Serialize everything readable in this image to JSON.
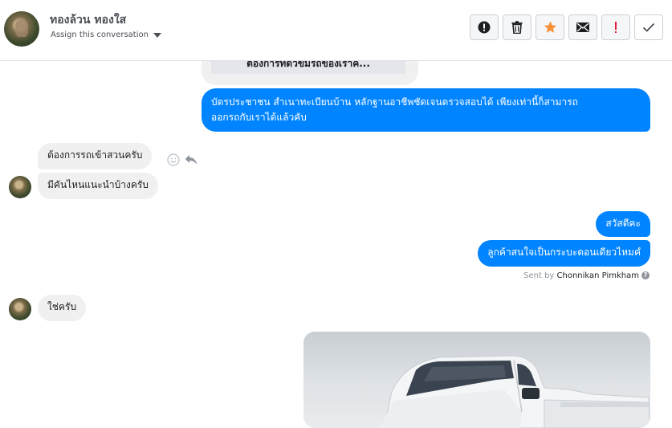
{
  "header": {
    "contact_name": "ทองล้วน ทองใส",
    "assign_label": "Assign this conversation",
    "toolbar": [
      {
        "name": "alert-circle-icon",
        "label": "Mark as spam"
      },
      {
        "name": "trash-icon",
        "label": "Delete"
      },
      {
        "name": "star-icon",
        "label": "Star"
      },
      {
        "name": "envelope-icon",
        "label": "Mark as unread"
      },
      {
        "name": "exclamation-icon",
        "label": "Important"
      },
      {
        "name": "check-icon",
        "label": "Done"
      }
    ]
  },
  "conversation": {
    "quoted_preview": "ต้องการทดวขมรถของเราค...",
    "messages": [
      {
        "dir": "out",
        "text_line1": "บัตรประชาชน สำเนาทะเบียนบ้าน หลักฐานอาชีพชัดเจนตรวจสอบได้ เพียงเท่านี้ก็สามารถ",
        "text_line2": "ออกรถกับเราได้แล้วคับ"
      },
      {
        "dir": "in",
        "text": "ต้องการรถเข้าสวนครับ"
      },
      {
        "dir": "in",
        "text": "มีคันไหนแนะนำบ้างครับ"
      },
      {
        "dir": "out",
        "text": "สวัสดีคะ"
      },
      {
        "dir": "out",
        "text": "ลูกค้าสนใจเป็นกระบะตอนเดียวไหมคํ"
      },
      {
        "dir": "in",
        "text": "ใช่ครับ"
      }
    ],
    "sent_by_prefix": "Sent by",
    "sent_by_name": "Chonnikan Pimkham",
    "help_glyph": "?"
  },
  "colors": {
    "outgoing": "#0084ff",
    "incoming": "#f1f0f0",
    "star": "#f7923a",
    "important": "#e41e3f"
  }
}
